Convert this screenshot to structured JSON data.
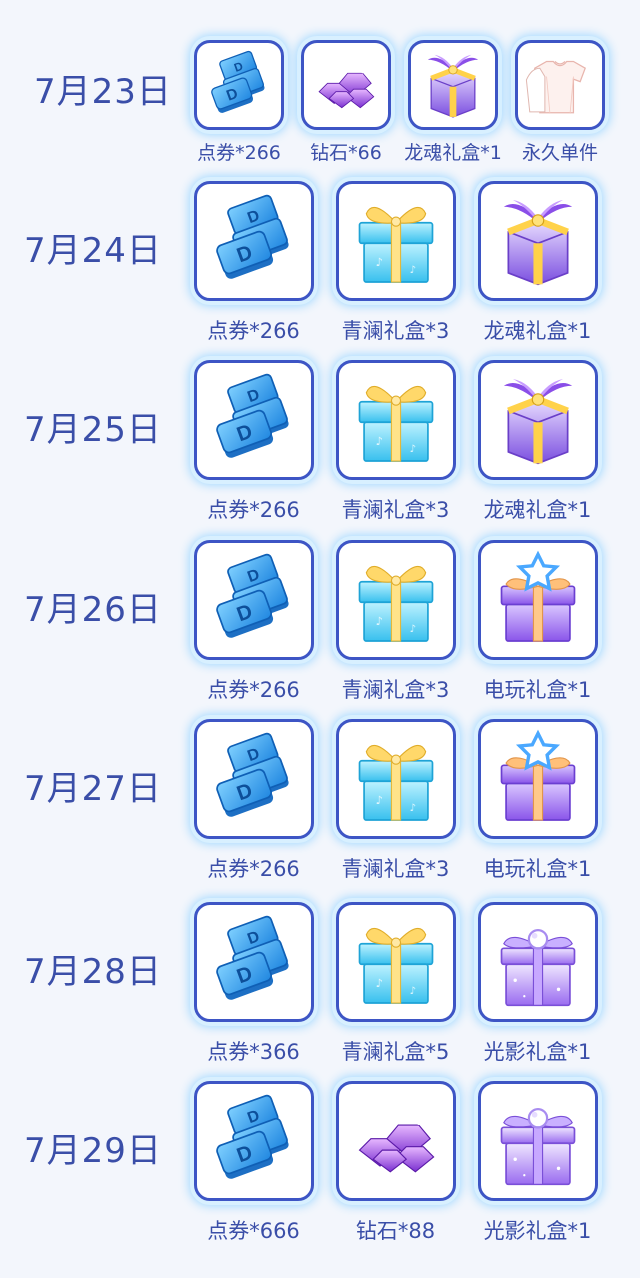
{
  "days": [
    {
      "date": "7月23日",
      "items": [
        {
          "icon": "voucher-icon",
          "label": "点券*266"
        },
        {
          "icon": "diamond-icon",
          "label": "钻石*66"
        },
        {
          "icon": "dragon-soul-gift-box-icon",
          "label": "龙魂礼盒*1"
        },
        {
          "icon": "clothing-icon",
          "label": "永久单件"
        }
      ]
    },
    {
      "date": "7月24日",
      "items": [
        {
          "icon": "voucher-icon",
          "label": "点券*266"
        },
        {
          "icon": "qinglan-gift-box-icon",
          "label": "青澜礼盒*3"
        },
        {
          "icon": "dragon-soul-gift-box-icon",
          "label": "龙魂礼盒*1"
        }
      ]
    },
    {
      "date": "7月25日",
      "items": [
        {
          "icon": "voucher-icon",
          "label": "点券*266"
        },
        {
          "icon": "qinglan-gift-box-icon",
          "label": "青澜礼盒*3"
        },
        {
          "icon": "dragon-soul-gift-box-icon",
          "label": "龙魂礼盒*1"
        }
      ]
    },
    {
      "date": "7月26日",
      "items": [
        {
          "icon": "voucher-icon",
          "label": "点券*266"
        },
        {
          "icon": "qinglan-gift-box-icon",
          "label": "青澜礼盒*3"
        },
        {
          "icon": "video-game-gift-box-icon",
          "label": "电玩礼盒*1"
        }
      ]
    },
    {
      "date": "7月27日",
      "items": [
        {
          "icon": "voucher-icon",
          "label": "点券*266"
        },
        {
          "icon": "qinglan-gift-box-icon",
          "label": "青澜礼盒*3"
        },
        {
          "icon": "video-game-gift-box-icon",
          "label": "电玩礼盒*1"
        }
      ]
    },
    {
      "date": "7月28日",
      "items": [
        {
          "icon": "voucher-icon",
          "label": "点券*366"
        },
        {
          "icon": "qinglan-gift-box-icon",
          "label": "青澜礼盒*5"
        },
        {
          "icon": "light-shadow-gift-box-icon",
          "label": "光影礼盒*1"
        }
      ]
    },
    {
      "date": "7月29日",
      "items": [
        {
          "icon": "voucher-icon",
          "label": "点券*666"
        },
        {
          "icon": "diamond-icon",
          "label": "钻石*88"
        },
        {
          "icon": "light-shadow-gift-box-icon",
          "label": "光影礼盒*1"
        }
      ]
    }
  ]
}
